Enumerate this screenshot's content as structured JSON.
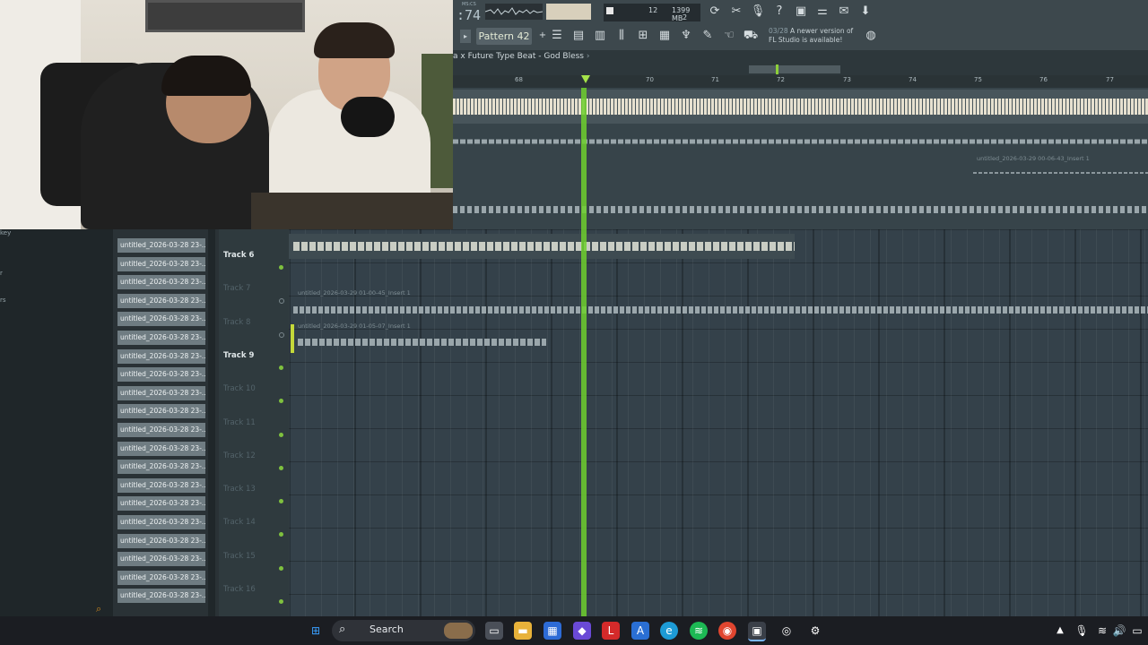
{
  "toolbar": {
    "tempo": ":74",
    "tempo_small": "MS:CS",
    "cpu_counter": "12",
    "memory": "1399 MB",
    "voices": "2",
    "pattern": "Pattern 42",
    "news_date": "03/28",
    "news_text_1": "A newer version of",
    "news_text_2": "FL Studio is available!"
  },
  "playlist": {
    "breadcrumb": "a x Future Type Beat - God Bless",
    "breadcrumb_arrow": "›",
    "ruler_ticks": [
      "68",
      "70",
      "71",
      "72",
      "73",
      "74",
      "75",
      "76",
      "77"
    ]
  },
  "clips": {
    "clip_a": "untitled_2026-03-29 00-06-43_Insert 1",
    "clip_b": "untitled_2026-03-29 01-00-45_Insert 1",
    "clip_c": "untitled_2026-03-29 01-05-07_Insert 1"
  },
  "browser_left": {
    "item1": "key",
    "item2": "r",
    "item3": "rs"
  },
  "browser": {
    "items": [
      "untitled_2026-03-28 23-...",
      "untitled_2026-03-28 23-...",
      "untitled_2026-03-28 23-...",
      "untitled_2026-03-28 23-...",
      "untitled_2026-03-28 23-...",
      "untitled_2026-03-28 23-...",
      "untitled_2026-03-28 23-...",
      "untitled_2026-03-28 23-...",
      "untitled_2026-03-28 23-...",
      "untitled_2026-03-28 23-...",
      "untitled_2026-03-28 23-...",
      "untitled_2026-03-28 23-...",
      "untitled_2026-03-28 23-...",
      "untitled_2026-03-28 23-...",
      "untitled_2026-03-28 23-...",
      "untitled_2026-03-28 23-...",
      "untitled_2026-03-28 23-...",
      "untitled_2026-03-28 23-...",
      "untitled_2026-03-28 23-...",
      "untitled_2026-03-28 23-..."
    ]
  },
  "tracks": [
    {
      "name": "Track 6",
      "active": true
    },
    {
      "name": "Track 7",
      "active": false
    },
    {
      "name": "Track 8",
      "active": false
    },
    {
      "name": "Track 9",
      "active": true
    },
    {
      "name": "Track 10",
      "active": false
    },
    {
      "name": "Track 11",
      "active": false
    },
    {
      "name": "Track 12",
      "active": false
    },
    {
      "name": "Track 13",
      "active": false
    },
    {
      "name": "Track 14",
      "active": false
    },
    {
      "name": "Track 15",
      "active": false
    },
    {
      "name": "Track 16",
      "active": false
    }
  ],
  "taskbar": {
    "search_label": "Search"
  },
  "colors": {
    "playhead": "#6fcf2e",
    "wave_light": "#e6e0cf",
    "wave_gray": "#9aa6ab"
  }
}
